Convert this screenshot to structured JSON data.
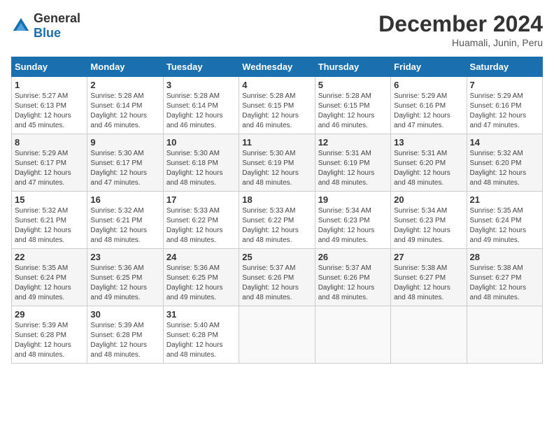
{
  "header": {
    "logo": {
      "text_general": "General",
      "text_blue": "Blue"
    },
    "title": "December 2024",
    "location": "Huamali, Junin, Peru"
  },
  "calendar": {
    "days_of_week": [
      "Sunday",
      "Monday",
      "Tuesday",
      "Wednesday",
      "Thursday",
      "Friday",
      "Saturday"
    ],
    "weeks": [
      [
        {
          "day": "1",
          "info": "Sunrise: 5:27 AM\nSunset: 6:13 PM\nDaylight: 12 hours\nand 45 minutes."
        },
        {
          "day": "2",
          "info": "Sunrise: 5:28 AM\nSunset: 6:14 PM\nDaylight: 12 hours\nand 46 minutes."
        },
        {
          "day": "3",
          "info": "Sunrise: 5:28 AM\nSunset: 6:14 PM\nDaylight: 12 hours\nand 46 minutes."
        },
        {
          "day": "4",
          "info": "Sunrise: 5:28 AM\nSunset: 6:15 PM\nDaylight: 12 hours\nand 46 minutes."
        },
        {
          "day": "5",
          "info": "Sunrise: 5:28 AM\nSunset: 6:15 PM\nDaylight: 12 hours\nand 46 minutes."
        },
        {
          "day": "6",
          "info": "Sunrise: 5:29 AM\nSunset: 6:16 PM\nDaylight: 12 hours\nand 47 minutes."
        },
        {
          "day": "7",
          "info": "Sunrise: 5:29 AM\nSunset: 6:16 PM\nDaylight: 12 hours\nand 47 minutes."
        }
      ],
      [
        {
          "day": "8",
          "info": "Sunrise: 5:29 AM\nSunset: 6:17 PM\nDaylight: 12 hours\nand 47 minutes."
        },
        {
          "day": "9",
          "info": "Sunrise: 5:30 AM\nSunset: 6:17 PM\nDaylight: 12 hours\nand 47 minutes."
        },
        {
          "day": "10",
          "info": "Sunrise: 5:30 AM\nSunset: 6:18 PM\nDaylight: 12 hours\nand 48 minutes."
        },
        {
          "day": "11",
          "info": "Sunrise: 5:30 AM\nSunset: 6:19 PM\nDaylight: 12 hours\nand 48 minutes."
        },
        {
          "day": "12",
          "info": "Sunrise: 5:31 AM\nSunset: 6:19 PM\nDaylight: 12 hours\nand 48 minutes."
        },
        {
          "day": "13",
          "info": "Sunrise: 5:31 AM\nSunset: 6:20 PM\nDaylight: 12 hours\nand 48 minutes."
        },
        {
          "day": "14",
          "info": "Sunrise: 5:32 AM\nSunset: 6:20 PM\nDaylight: 12 hours\nand 48 minutes."
        }
      ],
      [
        {
          "day": "15",
          "info": "Sunrise: 5:32 AM\nSunset: 6:21 PM\nDaylight: 12 hours\nand 48 minutes."
        },
        {
          "day": "16",
          "info": "Sunrise: 5:32 AM\nSunset: 6:21 PM\nDaylight: 12 hours\nand 48 minutes."
        },
        {
          "day": "17",
          "info": "Sunrise: 5:33 AM\nSunset: 6:22 PM\nDaylight: 12 hours\nand 48 minutes."
        },
        {
          "day": "18",
          "info": "Sunrise: 5:33 AM\nSunset: 6:22 PM\nDaylight: 12 hours\nand 48 minutes."
        },
        {
          "day": "19",
          "info": "Sunrise: 5:34 AM\nSunset: 6:23 PM\nDaylight: 12 hours\nand 49 minutes."
        },
        {
          "day": "20",
          "info": "Sunrise: 5:34 AM\nSunset: 6:23 PM\nDaylight: 12 hours\nand 49 minutes."
        },
        {
          "day": "21",
          "info": "Sunrise: 5:35 AM\nSunset: 6:24 PM\nDaylight: 12 hours\nand 49 minutes."
        }
      ],
      [
        {
          "day": "22",
          "info": "Sunrise: 5:35 AM\nSunset: 6:24 PM\nDaylight: 12 hours\nand 49 minutes."
        },
        {
          "day": "23",
          "info": "Sunrise: 5:36 AM\nSunset: 6:25 PM\nDaylight: 12 hours\nand 49 minutes."
        },
        {
          "day": "24",
          "info": "Sunrise: 5:36 AM\nSunset: 6:25 PM\nDaylight: 12 hours\nand 49 minutes."
        },
        {
          "day": "25",
          "info": "Sunrise: 5:37 AM\nSunset: 6:26 PM\nDaylight: 12 hours\nand 48 minutes."
        },
        {
          "day": "26",
          "info": "Sunrise: 5:37 AM\nSunset: 6:26 PM\nDaylight: 12 hours\nand 48 minutes."
        },
        {
          "day": "27",
          "info": "Sunrise: 5:38 AM\nSunset: 6:27 PM\nDaylight: 12 hours\nand 48 minutes."
        },
        {
          "day": "28",
          "info": "Sunrise: 5:38 AM\nSunset: 6:27 PM\nDaylight: 12 hours\nand 48 minutes."
        }
      ],
      [
        {
          "day": "29",
          "info": "Sunrise: 5:39 AM\nSunset: 6:28 PM\nDaylight: 12 hours\nand 48 minutes."
        },
        {
          "day": "30",
          "info": "Sunrise: 5:39 AM\nSunset: 6:28 PM\nDaylight: 12 hours\nand 48 minutes."
        },
        {
          "day": "31",
          "info": "Sunrise: 5:40 AM\nSunset: 6:28 PM\nDaylight: 12 hours\nand 48 minutes."
        },
        {
          "day": "",
          "info": ""
        },
        {
          "day": "",
          "info": ""
        },
        {
          "day": "",
          "info": ""
        },
        {
          "day": "",
          "info": ""
        }
      ]
    ]
  }
}
